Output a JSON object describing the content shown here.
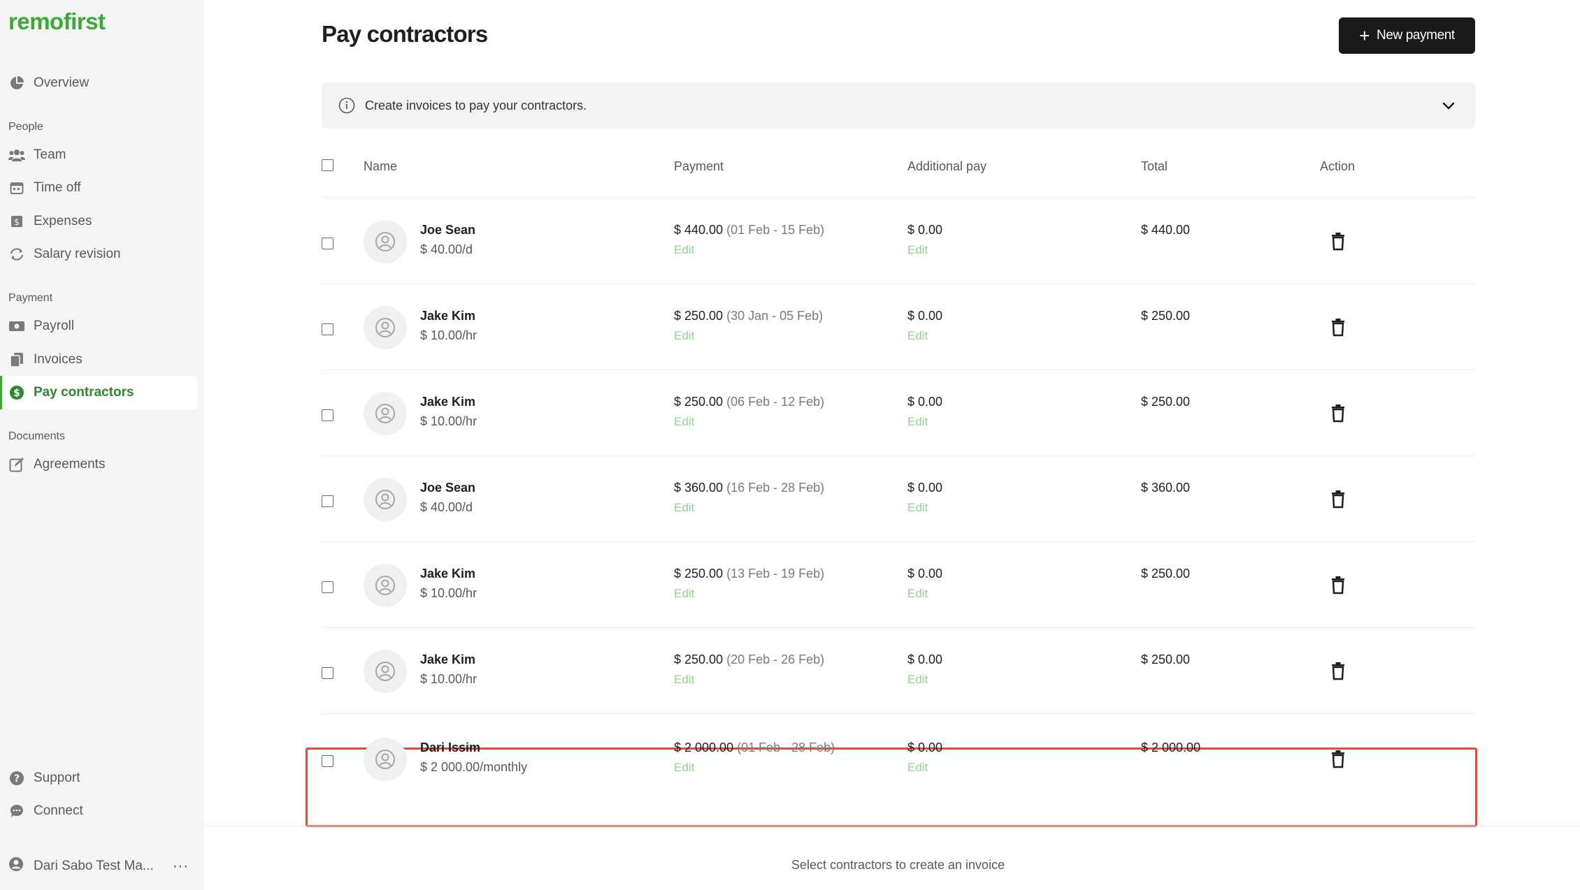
{
  "brand": {
    "logo": "remofirst",
    "accent": "#3aa935"
  },
  "sidebar": {
    "overview": "Overview",
    "sections": {
      "people": "People",
      "payment": "Payment",
      "documents": "Documents"
    },
    "people_items": [
      "Team",
      "Time off",
      "Expenses",
      "Salary revision"
    ],
    "payment_items": [
      "Payroll",
      "Invoices",
      "Pay contractors"
    ],
    "documents_items": [
      "Agreements"
    ],
    "bottom_items": [
      "Support",
      "Connect"
    ],
    "user": {
      "name": "Dari Sabo Test Ma...",
      "more": "···"
    },
    "active_item": "Pay contractors"
  },
  "page": {
    "title": "Pay contractors",
    "new_payment_label": "New payment",
    "info_text": "Create invoices to pay your contractors."
  },
  "table": {
    "headers": {
      "name": "Name",
      "payment": "Payment",
      "additional": "Additional pay",
      "total": "Total",
      "action": "Action"
    },
    "edit_label": "Edit",
    "rows": [
      {
        "name": "Joe Sean",
        "rate": "$ 40.00/d",
        "payment": "$ 440.00",
        "period": "(01 Feb - 15 Feb)",
        "additional": "$ 0.00",
        "total": "$ 440.00"
      },
      {
        "name": "Jake Kim",
        "rate": "$ 10.00/hr",
        "payment": "$ 250.00",
        "period": "(30 Jan - 05 Feb)",
        "additional": "$ 0.00",
        "total": "$ 250.00"
      },
      {
        "name": "Jake Kim",
        "rate": "$ 10.00/hr",
        "payment": "$ 250.00",
        "period": "(06 Feb - 12 Feb)",
        "additional": "$ 0.00",
        "total": "$ 250.00"
      },
      {
        "name": "Joe Sean",
        "rate": "$ 40.00/d",
        "payment": "$ 360.00",
        "period": "(16 Feb - 28 Feb)",
        "additional": "$ 0.00",
        "total": "$ 360.00"
      },
      {
        "name": "Jake Kim",
        "rate": "$ 10.00/hr",
        "payment": "$ 250.00",
        "period": "(13 Feb - 19 Feb)",
        "additional": "$ 0.00",
        "total": "$ 250.00"
      },
      {
        "name": "Jake Kim",
        "rate": "$ 10.00/hr",
        "payment": "$ 250.00",
        "period": "(20 Feb - 26 Feb)",
        "additional": "$ 0.00",
        "total": "$ 250.00"
      },
      {
        "name": "Dari Issim",
        "rate": "$ 2 000.00/monthly",
        "payment": "$ 2 000.00",
        "period": "(01 Feb - 28 Feb)",
        "additional": "$ 0.00",
        "total": "$ 2 000.00"
      }
    ],
    "highlighted_row": 7
  },
  "footer": {
    "hint": "Select contractors to create an invoice"
  }
}
